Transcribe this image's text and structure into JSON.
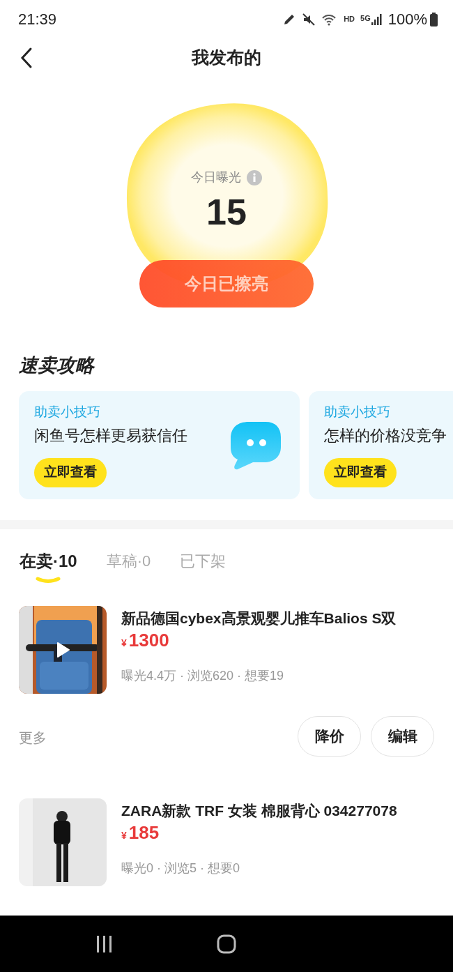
{
  "status_bar": {
    "time": "21:39",
    "network": "HD",
    "cellular": "5G",
    "battery": "100%"
  },
  "header": {
    "title": "我发布的"
  },
  "exposure": {
    "label": "今日曝光",
    "value": "15",
    "button": "今日已擦亮"
  },
  "tips": {
    "title": "速卖攻略",
    "cards": [
      {
        "tag": "助卖小技巧",
        "title": "闲鱼号怎样更易获信任",
        "button": "立即查看",
        "icon": true
      },
      {
        "tag": "助卖小技巧",
        "title": "怎样的价格没竞争",
        "button": "立即查看"
      }
    ]
  },
  "tabs": [
    {
      "label": "在卖·10",
      "selected": true
    },
    {
      "label": "草稿·0",
      "selected": false
    },
    {
      "label": "已下架",
      "selected": false
    }
  ],
  "items": [
    {
      "title": "新品德国cybex高景观婴儿推车Balios S双",
      "currency": "¥",
      "price": "1300",
      "stats": "曝光4.4万 · 浏览620 · 想要19",
      "video": true,
      "more": "更多",
      "actions": [
        "降价",
        "编辑"
      ]
    },
    {
      "title": "ZARA新款 TRF 女装 棉服背心 034277078",
      "currency": "¥",
      "price": "185",
      "stats": "曝光0 · 浏览5 · 想要0",
      "video": false
    }
  ]
}
